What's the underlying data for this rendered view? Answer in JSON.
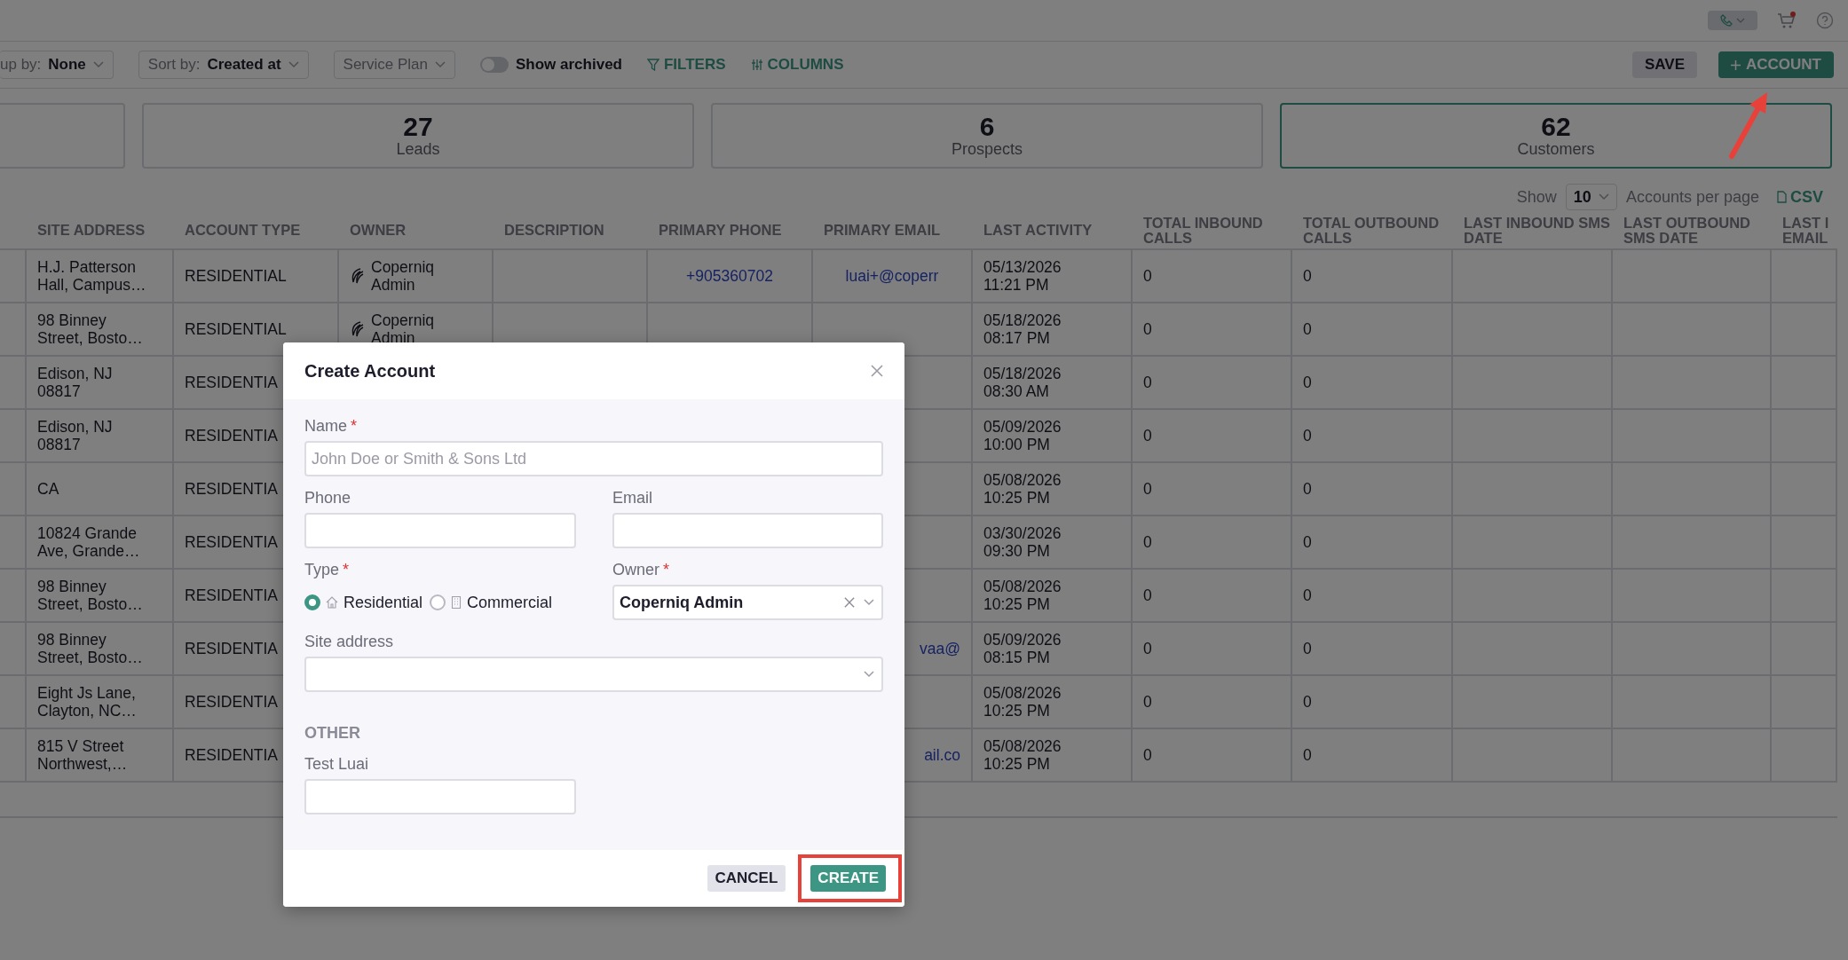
{
  "toolbar": {
    "group_by": {
      "label": "up by:",
      "value": "None"
    },
    "sort_by": {
      "label": "Sort by:",
      "value": "Created at"
    },
    "service_plan": {
      "label": "Service Plan"
    },
    "show_archived": {
      "label": "Show archived",
      "on": false
    },
    "filters": "FILTERS",
    "columns": "COLUMNS",
    "save": "SAVE",
    "add_account": "ACCOUNT"
  },
  "stats": [
    {
      "selected": false
    },
    {
      "count": "27",
      "label": "Leads",
      "selected": false
    },
    {
      "count": "6",
      "label": "Prospects",
      "selected": false
    },
    {
      "count": "62",
      "label": "Customers",
      "selected": true
    }
  ],
  "pagination": {
    "show_label": "Show",
    "per_page": "10",
    "suffix": "Accounts per page",
    "export": "CSV"
  },
  "table": {
    "columns": [
      "SITE ADDRESS",
      "ACCOUNT TYPE",
      "OWNER",
      "DESCRIPTION",
      "PRIMARY PHONE",
      "PRIMARY EMAIL",
      "LAST ACTIVITY",
      "TOTAL INBOUND CALLS",
      "TOTAL OUTBOUND CALLS",
      "LAST INBOUND SMS DATE",
      "LAST OUTBOUND SMS DATE",
      "LAST I EMAIL"
    ],
    "rows": [
      {
        "site_address": "H.J. Patterson Hall, Campus…",
        "account_type": "RESIDENTIAL",
        "owner": "Coperniq Admin",
        "primary_phone": "+905360702",
        "primary_email": "luai+@coperr",
        "last_activity": "05/13/2026 11:21 PM",
        "total_inbound_calls": "0",
        "total_outbound_calls": "0"
      },
      {
        "site_address": "98 Binney Street, Bosto…",
        "account_type": "RESIDENTIAL",
        "owner": "Coperniq Admin",
        "last_activity": "05/18/2026 08:17 PM",
        "total_inbound_calls": "0",
        "total_outbound_calls": "0"
      },
      {
        "site_address": "Edison, NJ 08817",
        "account_type": "RESIDENTIA",
        "last_activity": "05/18/2026 08:30 AM",
        "total_inbound_calls": "0",
        "total_outbound_calls": "0"
      },
      {
        "site_address": "Edison, NJ 08817",
        "account_type": "RESIDENTIA",
        "last_activity": "05/09/2026 10:00 PM",
        "total_inbound_calls": "0",
        "total_outbound_calls": "0"
      },
      {
        "site_address": "CA",
        "account_type": "RESIDENTIA",
        "last_activity": "05/08/2026 10:25 PM",
        "total_inbound_calls": "0",
        "total_outbound_calls": "0"
      },
      {
        "site_address": "10824 Grande Ave, Grande…",
        "account_type": "RESIDENTIA",
        "last_activity": "03/30/2026 09:30 PM",
        "total_inbound_calls": "0",
        "total_outbound_calls": "0"
      },
      {
        "site_address": "98 Binney Street, Bosto…",
        "account_type": "RESIDENTIA",
        "last_activity": "05/08/2026 10:25 PM",
        "total_inbound_calls": "0",
        "total_outbound_calls": "0"
      },
      {
        "site_address": "98 Binney Street, Bosto…",
        "account_type": "RESIDENTIA",
        "primary_email": "vaa@",
        "primary_email_clipped": true,
        "last_activity": "05/09/2026 08:15 PM",
        "total_inbound_calls": "0",
        "total_outbound_calls": "0"
      },
      {
        "site_address": "Eight Js Lane, Clayton, NC…",
        "account_type": "RESIDENTIA",
        "last_activity": "05/08/2026 10:25 PM",
        "total_inbound_calls": "0",
        "total_outbound_calls": "0"
      },
      {
        "site_address": "815 V Street Northwest,…",
        "account_type": "RESIDENTIA",
        "primary_email": "ail.co",
        "primary_email_clipped": true,
        "last_activity": "05/08/2026 10:25 PM",
        "total_inbound_calls": "0",
        "total_outbound_calls": "0"
      }
    ]
  },
  "modal": {
    "title": "Create Account",
    "name": {
      "label": "Name",
      "required_mark": "*",
      "placeholder": "John Doe or Smith & Sons Ltd"
    },
    "phone": {
      "label": "Phone"
    },
    "email": {
      "label": "Email"
    },
    "type": {
      "label": "Type",
      "required_mark": "*",
      "options": [
        {
          "label": "Residential",
          "selected": true
        },
        {
          "label": "Commercial",
          "selected": false
        }
      ]
    },
    "owner": {
      "label": "Owner",
      "required_mark": "*",
      "value": "Coperniq Admin"
    },
    "site_address": {
      "label": "Site address"
    },
    "other": {
      "heading": "OTHER",
      "fields": [
        {
          "label": "Test Luai"
        }
      ]
    },
    "cancel": "CANCEL",
    "create": "CREATE"
  }
}
